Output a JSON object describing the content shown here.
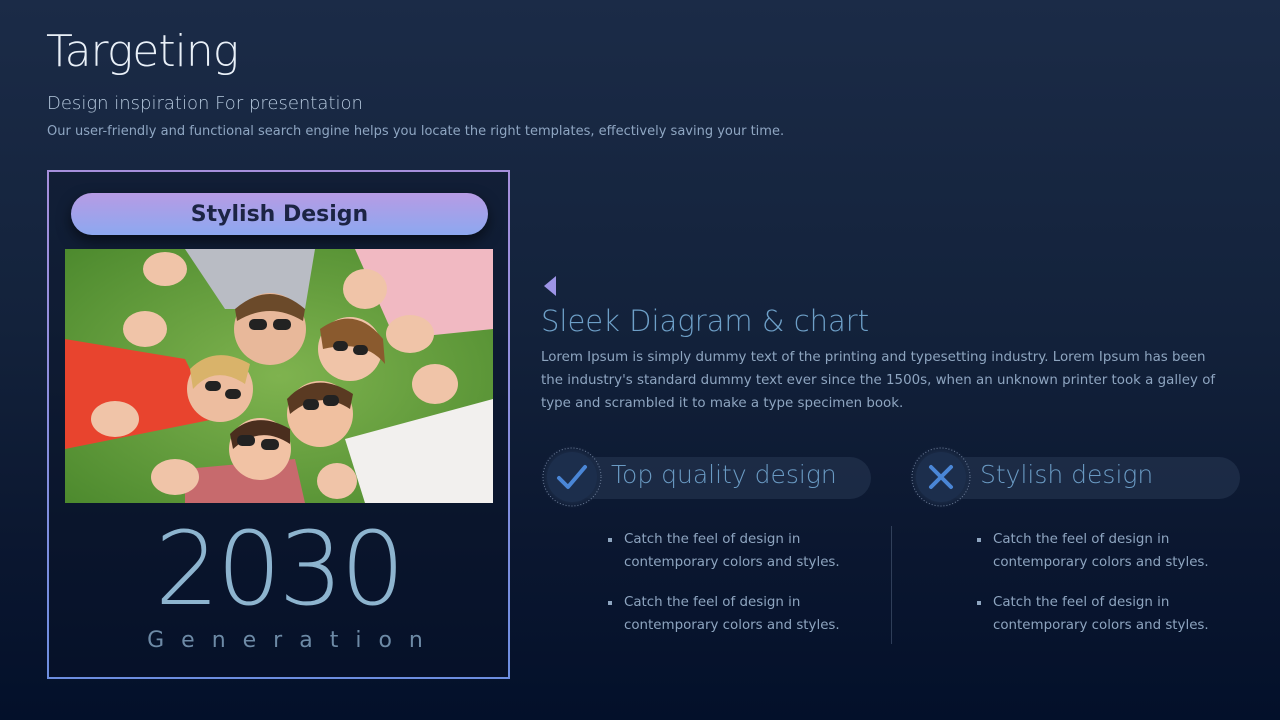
{
  "slide": {
    "title": "Targeting",
    "subtitle": "Design inspiration For presentation",
    "description": "Our user-friendly and functional search engine helps you locate the right templates, effectively saving your time."
  },
  "card": {
    "pill_label": "Stylish Design",
    "year": "2030",
    "caption": "Generation"
  },
  "section": {
    "title": "Sleek Diagram & chart",
    "body": "Lorem Ipsum is simply dummy text of the printing and typesetting industry. Lorem Ipsum has been the industry's standard dummy text ever since the 1500s, when an unknown printer took a galley of type and scrambled it to make a type specimen book."
  },
  "features": [
    {
      "label": "Top quality design",
      "icon": "check-icon",
      "bullets": [
        "Catch the feel of design in contemporary colors and styles.",
        "Catch the feel of design in contemporary colors and styles."
      ]
    },
    {
      "label": "Stylish design",
      "icon": "cross-icon",
      "bullets": [
        "Catch the feel of design in contemporary colors and styles.",
        "Catch the feel of design in contemporary colors and styles."
      ]
    }
  ],
  "colors": {
    "accent_purple": "#a68fdc",
    "accent_blue": "#4a86d6",
    "background": "#13223b"
  }
}
